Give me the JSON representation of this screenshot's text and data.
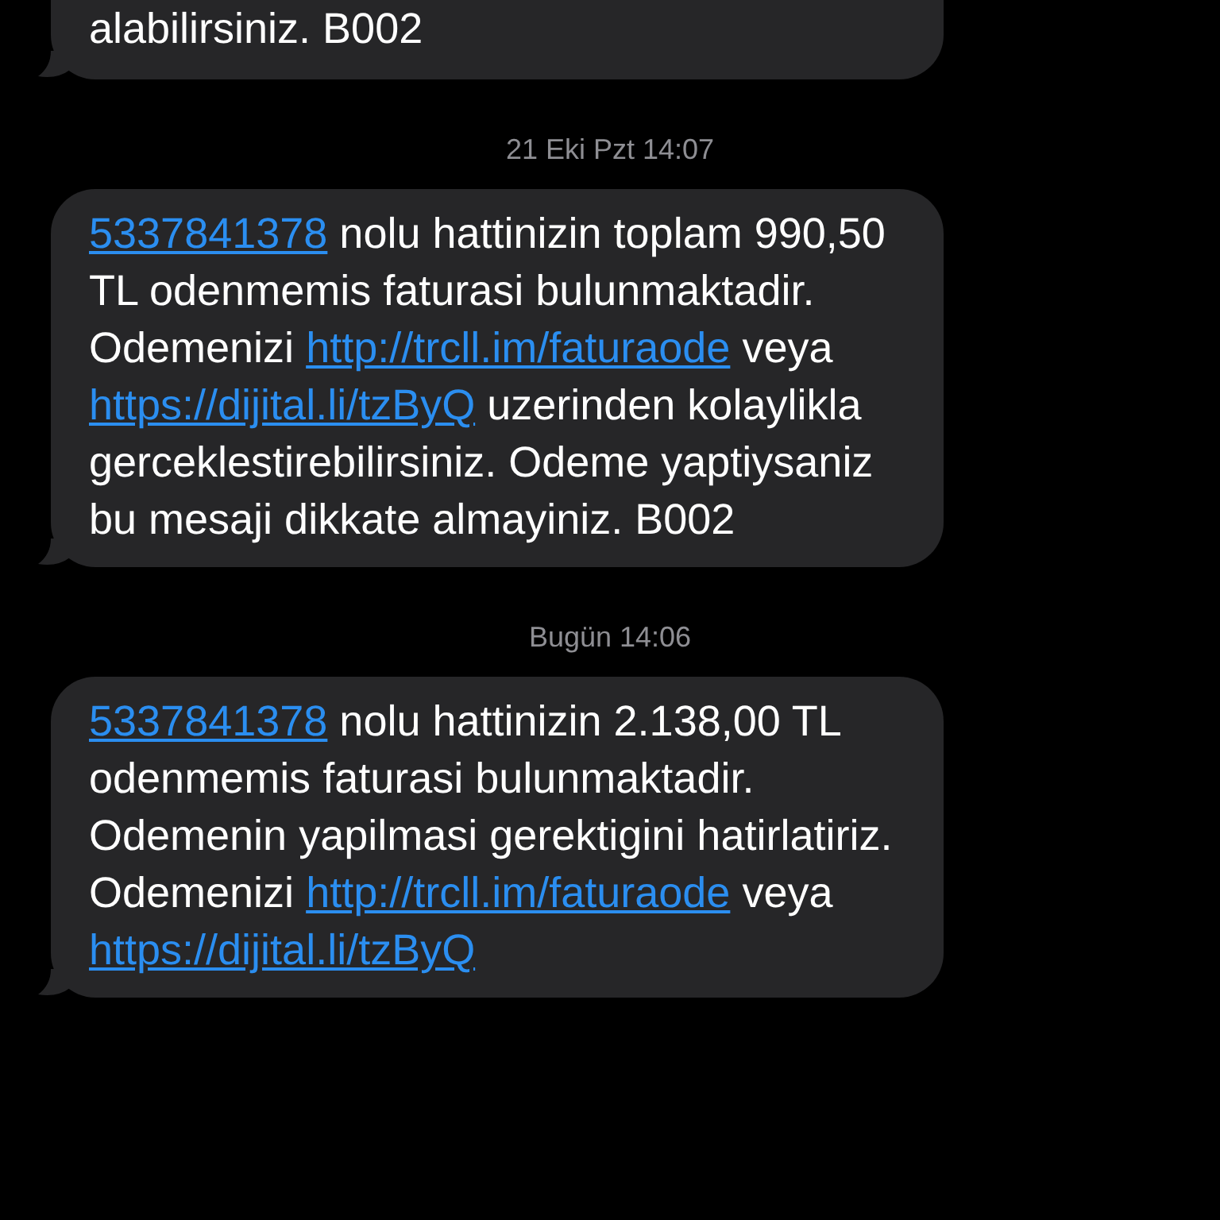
{
  "thread": [
    {
      "kind": "message",
      "segments": [
        {
          "kind": "text",
          "text": "alabilirsiniz. B002"
        }
      ]
    },
    {
      "kind": "timestamp",
      "text": "21 Eki Pzt 14:07"
    },
    {
      "kind": "message",
      "segments": [
        {
          "kind": "link",
          "text": "5337841378"
        },
        {
          "kind": "text",
          "text": " nolu hattinizin toplam 990,50 TL odenmemis faturasi bulunmaktadir. Odemenizi "
        },
        {
          "kind": "link",
          "text": "http://trcll.im/faturaode"
        },
        {
          "kind": "text",
          "text": " veya "
        },
        {
          "kind": "link",
          "text": "https://dijital.li/tzByQ"
        },
        {
          "kind": "text",
          "text": " uzerinden kolaylikla gerceklestirebilirsiniz. Odeme yaptiysaniz bu mesaji dikkate almayiniz. B002"
        }
      ]
    },
    {
      "kind": "timestamp",
      "text": "Bugün 14:06"
    },
    {
      "kind": "message",
      "segments": [
        {
          "kind": "link",
          "text": "5337841378"
        },
        {
          "kind": "text",
          "text": " nolu hattinizin 2.138,00 TL odenmemis faturasi bulunmaktadir. Odemenin yapilmasi gerektigini hatirlatiriz. Odemenizi "
        },
        {
          "kind": "link",
          "text": "http://trcll.im/faturaode"
        },
        {
          "kind": "text",
          "text": " veya "
        },
        {
          "kind": "link",
          "text": "https://dijital.li/tzByQ"
        }
      ]
    }
  ]
}
